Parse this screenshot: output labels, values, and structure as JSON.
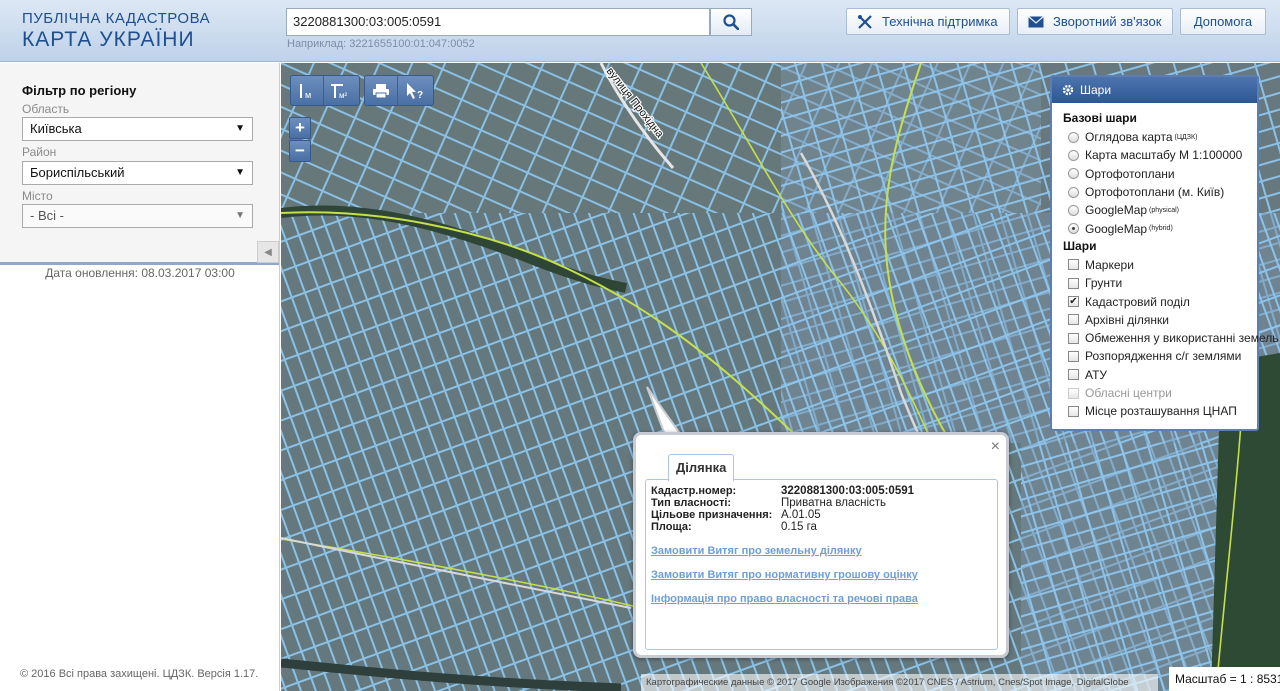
{
  "header": {
    "logo_line1": "ПУБЛІЧНА КАДАСТРОВА",
    "logo_line2": "КАРТА УКРАЇНИ",
    "search_value": "3220881300:03:005:0591",
    "search_example": "Наприклад: 3221655100:01:047:0052",
    "support_label": "Технічна підтримка",
    "feedback_label": "Зворотний зв'язок",
    "help_label": "Допомога"
  },
  "filter": {
    "title": "Фільтр по регіону",
    "oblast_label": "Область",
    "oblast_value": "Київська",
    "raion_label": "Район",
    "raion_value": "Бориспільський",
    "misto_label": "Місто",
    "misto_value": "- Всі -"
  },
  "left": {
    "update_date": "Дата оновлення: 08.03.2017 03:00",
    "copyright": "© 2016 Всі права захищені. ЦДЗК. Версія 1.17."
  },
  "map_tools": {
    "ruler_m": "м",
    "ruler_m2": "м²",
    "zoom_in": "+",
    "zoom_out": "−",
    "road_label": "вулиця Прохідна"
  },
  "layers": {
    "title": "Шари",
    "base_title": "Базові шари",
    "base": [
      {
        "label": "Оглядова карта",
        "sup": "(ЦДЗК)",
        "checked": false
      },
      {
        "label": "Карта масштабу М 1:100000",
        "sup": "",
        "checked": false
      },
      {
        "label": "Ортофотоплани",
        "sup": "",
        "checked": false
      },
      {
        "label": "Ортофотоплани (м. Київ)",
        "sup": "",
        "checked": false
      },
      {
        "label": "GoogleMap",
        "sup": "(physical)",
        "checked": false
      },
      {
        "label": "GoogleMap",
        "sup": "(hybrid)",
        "checked": true
      }
    ],
    "overlay_title": "Шари",
    "overlays": [
      {
        "label": "Маркери",
        "checked": false,
        "disabled": false
      },
      {
        "label": "Грунти",
        "checked": false,
        "disabled": false
      },
      {
        "label": "Кадастровий поділ",
        "checked": true,
        "disabled": false
      },
      {
        "label": "Архівні ділянки",
        "checked": false,
        "disabled": false
      },
      {
        "label": "Обмеження у використанні земель",
        "checked": false,
        "disabled": false
      },
      {
        "label": "Розпорядження с/г землями",
        "checked": false,
        "disabled": false
      },
      {
        "label": "АТУ",
        "checked": false,
        "disabled": false
      },
      {
        "label": "Обласні центри",
        "checked": false,
        "disabled": true
      },
      {
        "label": "Місце розташування ЦНАП",
        "checked": false,
        "disabled": false
      }
    ]
  },
  "popup": {
    "tab": "Ділянка",
    "close": "×",
    "rows": [
      {
        "key": "Кадастр.номер:",
        "value": "3220881300:03:005:0591"
      },
      {
        "key": "Тип власності:",
        "value": "Приватна власність"
      },
      {
        "key": "Цільове призначення:",
        "value": "А.01.05"
      },
      {
        "key": "Площа:",
        "value": "0.15 га"
      }
    ],
    "links": [
      "Замовити Витяг про земельну ділянку",
      "Замовити Витяг про нормативну грошову оцінку",
      "Інформація про право власності та речові права"
    ]
  },
  "footer": {
    "attribution": "Картографические данные © 2017 Google Изображения ©2017 CNES / Astrium, Cnes/Spot Image, DigitalGlobe",
    "scale": "Масштаб = 1 : 8531"
  },
  "colors": {
    "brand": "#1d4f91",
    "parcel_outline": "#8ec8f2",
    "boundary_line": "#c6e04a",
    "link": "#6f9fd6"
  }
}
